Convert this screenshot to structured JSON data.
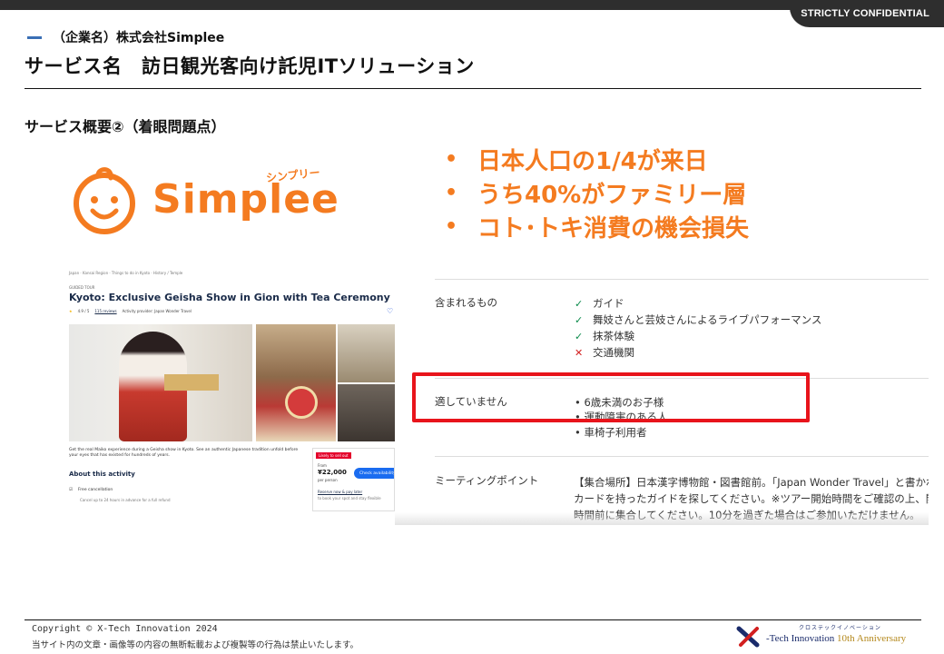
{
  "header": {
    "confidential_label": "STRICTLY CONFIDENTIAL",
    "company": "（企業名）株式会社Simplee",
    "title": "サービス名　訪日観光客向け託児ITソリューション",
    "section": "サービス概要②（着眼問題点）"
  },
  "logo": {
    "word": "Simplee",
    "kana": "シンプリー"
  },
  "bullets": [
    "日本人口の1/4が来日",
    "うち40%がファミリー層",
    "コト･トキ消費の機会損失"
  ],
  "tour_page": {
    "breadcrumb": "Japan · Kansai Region · Things to do in Kyoto · History / Temple",
    "tag": "GUIDED TOUR",
    "title": "Kyoto: Exclusive Geisha Show in Gion with Tea Ceremony",
    "rating": "4.9 / 5",
    "reviews": "115 reviews",
    "provider": "Activity provider: Japan Wonder Travel",
    "description": "Get the real Maiko experience during a Geisha show in Kyoto. See an authentic Japanese tradition unfold before your eyes that has existed for hundreds of years.",
    "about_heading": "About this activity",
    "free_cancellation": "Free cancellation",
    "free_cancellation_note": "Cancel up to 24 hours in advance for a full refund",
    "booking": {
      "badge": "Likely to sell out",
      "from": "From",
      "price": "¥22,000",
      "per_person": "per person",
      "check_button": "Check availability",
      "reserve": "Reserve now & pay later",
      "reserve_note": "to book your spot and stay flexible"
    }
  },
  "details": {
    "included_label": "含まれるもの",
    "included": [
      {
        "status": "ok",
        "text": "ガイド"
      },
      {
        "status": "ok",
        "text": "舞妓さんと芸妓さんによるライブパフォーマンス"
      },
      {
        "status": "ok",
        "text": "抹茶体験"
      },
      {
        "status": "ng",
        "text": "交通機関"
      }
    ],
    "not_suitable_label": "適していません",
    "not_suitable": [
      "6歳未満のお子様",
      "運動障害のある人",
      "車椅子利用者"
    ],
    "meeting_label": "ミーティングポイント",
    "meeting_text": "【集合場所】日本漢字博物館・図書館前。「Japan Wonder Travel」と書かれたカードを持ったガイドを探してください。※ツアー開始時間をご確認の上、開始時間前に集合してください。10分を過ぎた場合はご参加いただけません。"
  },
  "footer": {
    "copyright": "Copyright © X-Tech Innovation 2024",
    "notice": "当サイト内の文章・画像等の内容の無断転載および複製等の行為は禁止いたします。",
    "brand_kana": "クロステックイノベーション",
    "brand_name": "-Tech Innovation ",
    "brand_anniversary": "10th Anniversary"
  },
  "colors": {
    "accent_orange": "#f47b20",
    "highlight_red": "#e8141b",
    "accent_blue": "#3a6fb5"
  }
}
